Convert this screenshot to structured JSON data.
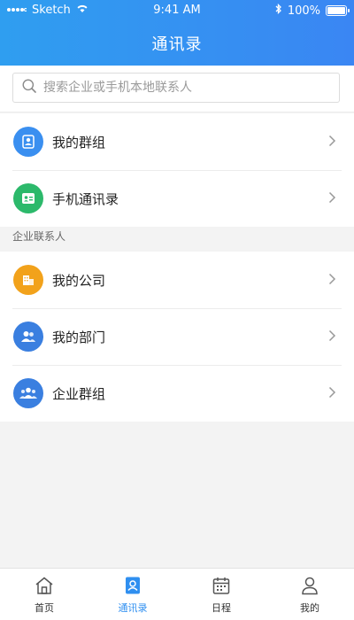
{
  "status_bar": {
    "carrier": "Sketch",
    "time": "9:41 AM",
    "battery": "100%"
  },
  "header": {
    "title": "通讯录"
  },
  "search": {
    "placeholder": "搜索企业或手机本地联系人"
  },
  "top_items": [
    {
      "label": "我的群组",
      "icon": "group-icon",
      "color": "#3a8ff0"
    },
    {
      "label": "手机通讯录",
      "icon": "contact-card-icon",
      "color": "#2cb96b"
    }
  ],
  "section_label": "企业联系人",
  "enterprise_items": [
    {
      "label": "我的公司",
      "icon": "company-icon",
      "color": "#f2a21b"
    },
    {
      "label": "我的部门",
      "icon": "department-icon",
      "color": "#3a7fe0"
    },
    {
      "label": "企业群组",
      "icon": "enterprise-group-icon",
      "color": "#3a7fe0"
    }
  ],
  "tabs": [
    {
      "label": "首页",
      "icon": "home-icon",
      "active": false
    },
    {
      "label": "通讯录",
      "icon": "contacts-icon",
      "active": true
    },
    {
      "label": "日程",
      "icon": "calendar-icon",
      "active": false
    },
    {
      "label": "我的",
      "icon": "profile-icon",
      "active": false
    }
  ],
  "colors": {
    "accent": "#2f8ff0",
    "header_start": "#2f9ef0",
    "header_end": "#3a86f3"
  }
}
